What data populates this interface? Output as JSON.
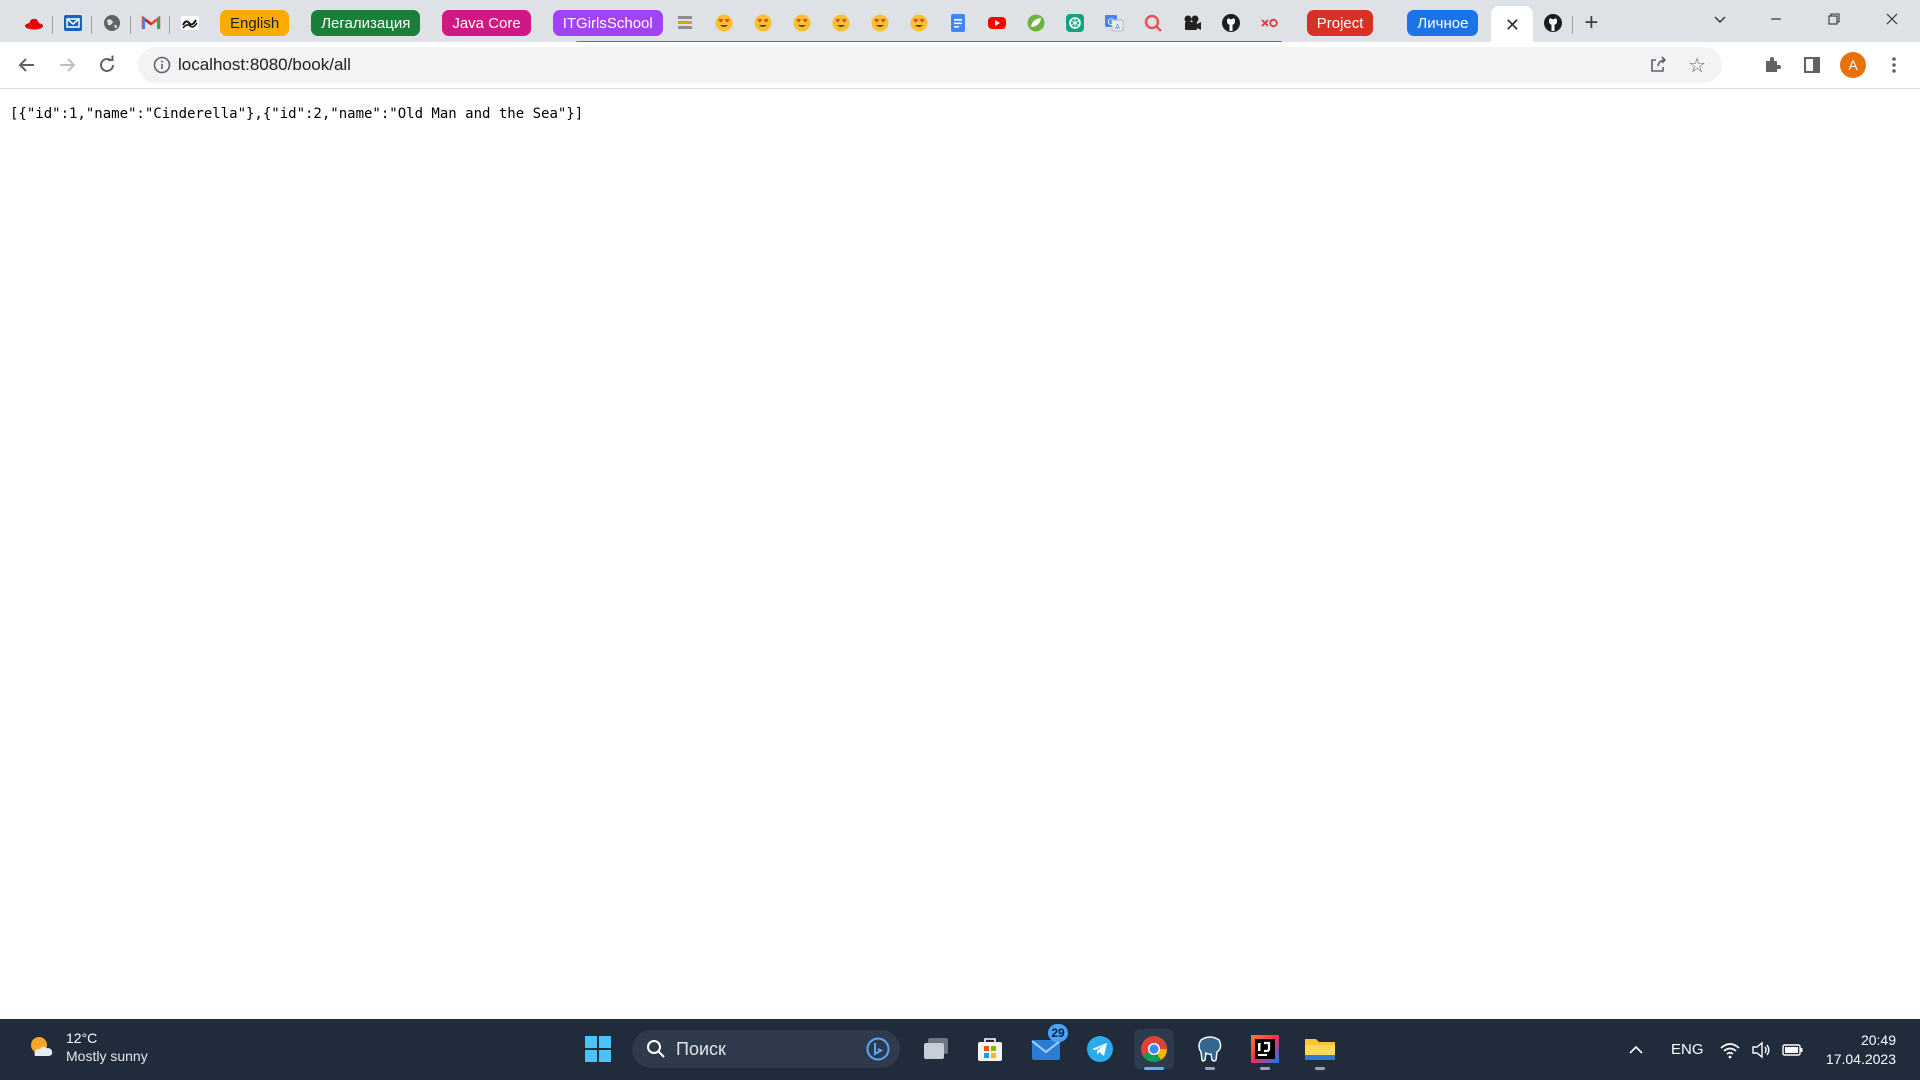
{
  "browser": {
    "tab_groups": [
      {
        "label": "English",
        "color": "#f9ab00",
        "text_color": "#202124"
      },
      {
        "label": "Легализация",
        "color": "#188038",
        "text_color": "#ffffff"
      },
      {
        "label": "Java Core",
        "color": "#d01884",
        "text_color": "#ffffff"
      },
      {
        "label": "ITGirlsSchool",
        "color": "#a142f4",
        "text_color": "#ffffff"
      },
      {
        "label": "Project",
        "color": "#d93025",
        "text_color": "#ffffff"
      },
      {
        "label": "Личное",
        "color": "#1a73e8",
        "text_color": "#ffffff"
      }
    ],
    "pinned_tab_icons_left": [
      "red-hat-icon",
      "mail-icon",
      "globe-icon",
      "gmail-icon",
      "wave-icon"
    ],
    "tab_icons_middle": [
      "list-icon",
      "heart-eyes-emoji-icon",
      "heart-eyes-emoji-icon",
      "heart-eyes-emoji-icon",
      "heart-eyes-emoji-icon",
      "heart-eyes-emoji-icon",
      "heart-eyes-emoji-icon",
      "docs-icon",
      "youtube-icon",
      "spring-leaf-icon",
      "chatgpt-icon",
      "translate-icon",
      "search-magnifier-icon",
      "film-icon",
      "github-icon",
      "xo-icon"
    ],
    "active_tab_close": "✕",
    "after_tab_icon": "github-icon",
    "new_tab_label": "+",
    "address_bar": {
      "url": "localhost:8080/book/all"
    },
    "profile_initial": "A"
  },
  "page": {
    "body_text": "[{\"id\":1,\"name\":\"Cinderella\"},{\"id\":2,\"name\":\"Old Man and the Sea\"}]"
  },
  "taskbar": {
    "weather_temp": "12°C",
    "weather_condition": "Mostly sunny",
    "search_placeholder": "Поиск",
    "mail_badge": "29",
    "language": "ENG",
    "time": "20:49",
    "date": "17.04.2023"
  }
}
